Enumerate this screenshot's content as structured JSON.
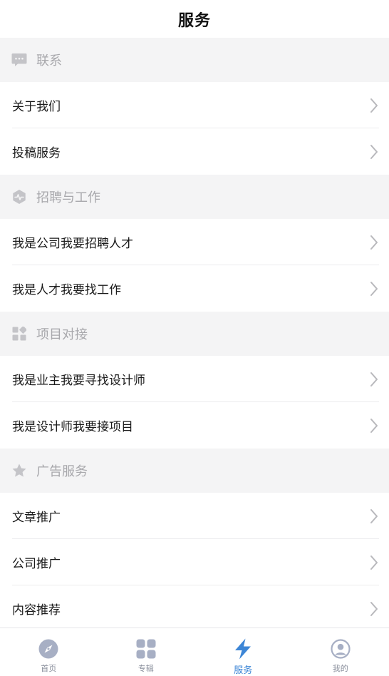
{
  "header": {
    "title": "服务"
  },
  "sections": [
    {
      "title": "联系",
      "icon": "chat-bubble-icon",
      "items": [
        "关于我们",
        "投稿服务"
      ]
    },
    {
      "title": "招聘与工作",
      "icon": "pulse-badge-icon",
      "items": [
        "我是公司我要招聘人才",
        "我是人才我要找工作"
      ]
    },
    {
      "title": "项目对接",
      "icon": "apps-grid-icon",
      "items": [
        "我是业主我要寻找设计师",
        "我是设计师我要接项目"
      ]
    },
    {
      "title": "广告服务",
      "icon": "star-icon",
      "items": [
        "文章推广",
        "公司推广",
        "内容推荐"
      ]
    }
  ],
  "tabbar": {
    "tabs": [
      {
        "label": "首页",
        "icon": "compass-icon"
      },
      {
        "label": "专辑",
        "icon": "grid-icon"
      },
      {
        "label": "服务",
        "icon": "lightning-icon"
      },
      {
        "label": "我的",
        "icon": "user-circle-icon"
      }
    ],
    "active_index": 2
  },
  "colors": {
    "section_bg": "#f4f4f5",
    "section_text": "#a8a8ac",
    "active_tab": "#3d86d6",
    "inactive_tab": "#8a8f9c",
    "chevron": "#b8b8bc"
  }
}
